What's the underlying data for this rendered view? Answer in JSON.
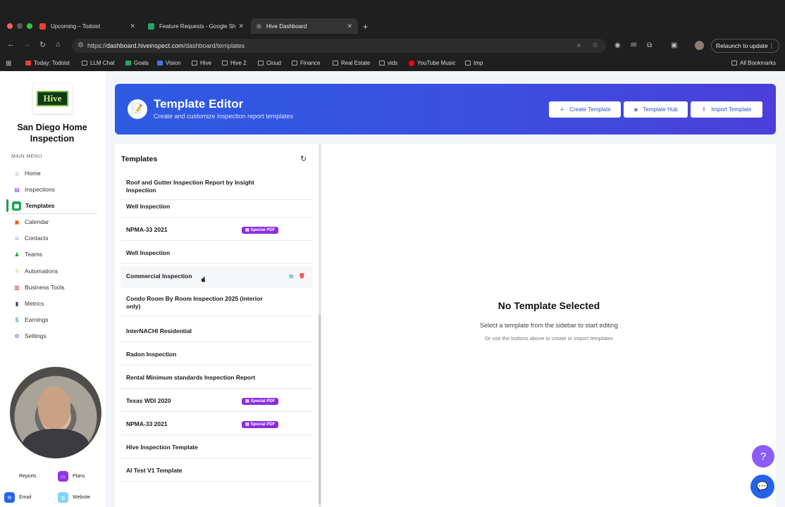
{
  "browser": {
    "tabs": [
      {
        "title": "Upcoming – Todoist",
        "color": "#e44332"
      },
      {
        "title": "Feature Requests - Google Sh",
        "color": "#23a566"
      },
      {
        "title": "Hive Dashboard",
        "color": "#777777"
      }
    ],
    "url_prefix": "https://",
    "url_host": "dashboard.hiveinspect.com",
    "url_path": "/dashboard/templates",
    "relaunch_label": "Relaunch to update",
    "bookmarks": [
      {
        "label": "Today: Todoist",
        "icon": "todoist-icon"
      },
      {
        "label": "LLM Chat",
        "icon": "folder-icon"
      },
      {
        "label": "Goals",
        "icon": "sheets-icon"
      },
      {
        "label": "Vision",
        "icon": "docs-icon"
      },
      {
        "label": "Hive",
        "icon": "folder-icon"
      },
      {
        "label": "Hive 2",
        "icon": "folder-icon"
      },
      {
        "label": "Cloud",
        "icon": "folder-icon"
      },
      {
        "label": "Finance",
        "icon": "folder-icon"
      },
      {
        "label": "Real Estate",
        "icon": "folder-icon"
      },
      {
        "label": "vids",
        "icon": "folder-icon"
      },
      {
        "label": "YouTube Music",
        "icon": "youtube-music-icon"
      },
      {
        "label": "tmp",
        "icon": "folder-icon"
      }
    ],
    "all_bookmarks": "All Bookmarks"
  },
  "sidebar": {
    "logo_text": "Hive",
    "company": "San Diego Home Inspection",
    "menu_label": "MAIN MENU",
    "items": [
      {
        "label": "Home",
        "icon": "home-icon",
        "color": "#2563eb"
      },
      {
        "label": "Inspections",
        "icon": "clipboard-icon",
        "color": "#7c3aed"
      },
      {
        "label": "Templates",
        "icon": "document-icon",
        "color": "#16a34a",
        "active": true
      },
      {
        "label": "Calendar",
        "icon": "calendar-icon",
        "color": "#ea580c"
      },
      {
        "label": "Contacts",
        "icon": "contacts-icon",
        "color": "#2563eb"
      },
      {
        "label": "Teams",
        "icon": "teams-icon",
        "color": "#16a34a"
      },
      {
        "label": "Automations",
        "icon": "lightning-icon",
        "color": "#eab308"
      },
      {
        "label": "Business Tools",
        "icon": "briefcase-icon",
        "color": "#dc2626"
      },
      {
        "label": "Metrics",
        "icon": "bar-chart-icon",
        "color": "#1e3a8a"
      },
      {
        "label": "Earnings",
        "icon": "dollar-icon",
        "color": "#16a34a"
      },
      {
        "label": "Settings",
        "icon": "gear-icon",
        "color": "#7c3aed"
      }
    ],
    "bottom": {
      "reports": "Reports",
      "plans": "Plans",
      "email": "Email",
      "website": "Website"
    }
  },
  "header": {
    "title": "Template Editor",
    "subtitle": "Create and customize inspection report templates",
    "create_label": "Create Template",
    "hub_label": "Template Hub",
    "import_label": "Import Template"
  },
  "templates": {
    "title": "Templates",
    "items": [
      {
        "name": "Roof and Gutter Inspection Report by Insight Inspection",
        "badge": ""
      },
      {
        "name": "Well Inspection",
        "badge": ""
      },
      {
        "name": "NPMA-33 2021",
        "badge": "Special PDF"
      },
      {
        "name": "Well Inspection",
        "badge": ""
      },
      {
        "name": "Commercial Inspection",
        "badge": "",
        "hovered": true
      },
      {
        "name": "Condo Room By Room Inspection 2025 (interior only)",
        "badge": ""
      },
      {
        "name": "InterNACHI Residential",
        "badge": ""
      },
      {
        "name": "Radon Inspection",
        "badge": ""
      },
      {
        "name": "Rental Minimum standards Inspection Report",
        "badge": ""
      },
      {
        "name": "Texas WDI 2020",
        "badge": "Special PDF"
      },
      {
        "name": "NPMA-33 2021",
        "badge": "Special PDF"
      },
      {
        "name": "Hive Inspection Template",
        "badge": ""
      },
      {
        "name": "AI Test V1 Template",
        "badge": ""
      }
    ]
  },
  "editor": {
    "empty_title": "No Template Selected",
    "empty_subtitle": "Select a template from the sidebar to start editing",
    "empty_hint": "Or use the buttons above to create or import templates"
  },
  "colors": {
    "accent": "#3a4fe0",
    "badge": "#8b2ce0",
    "active_green": "#16a34a",
    "help_fab": "#8b5cf6",
    "chat_fab": "#2563eb"
  }
}
